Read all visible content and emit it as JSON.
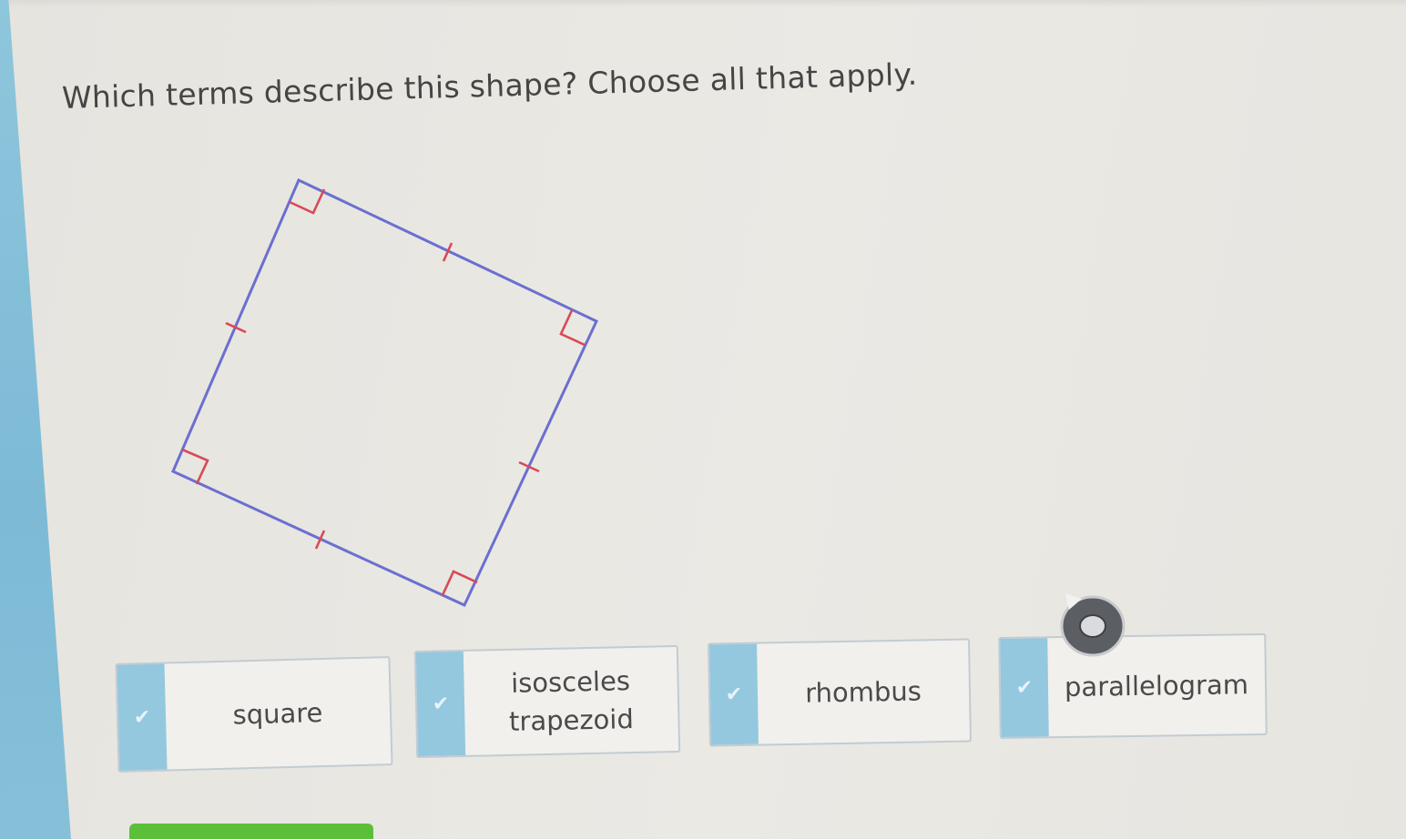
{
  "question": {
    "text": "Which terms describe this shape? Choose all that apply."
  },
  "shape": {
    "stroke_color": "#6b6fd0",
    "mark_color": "#d84a55",
    "right_angle_marks": 4,
    "tick_marks": 4
  },
  "choices": [
    {
      "label": "square",
      "check_icon": "checkmark-icon"
    },
    {
      "label_line1": "isosceles",
      "label_line2": "trapezoid",
      "check_icon": "checkmark-icon"
    },
    {
      "label": "rhombus",
      "check_icon": "checkmark-icon"
    },
    {
      "label": "parallelogram",
      "check_icon": "checkmark-icon"
    }
  ],
  "colors": {
    "check_tab": "#93c8df",
    "left_band": "#7dbad6",
    "submit_button": "#5bbf3a"
  }
}
